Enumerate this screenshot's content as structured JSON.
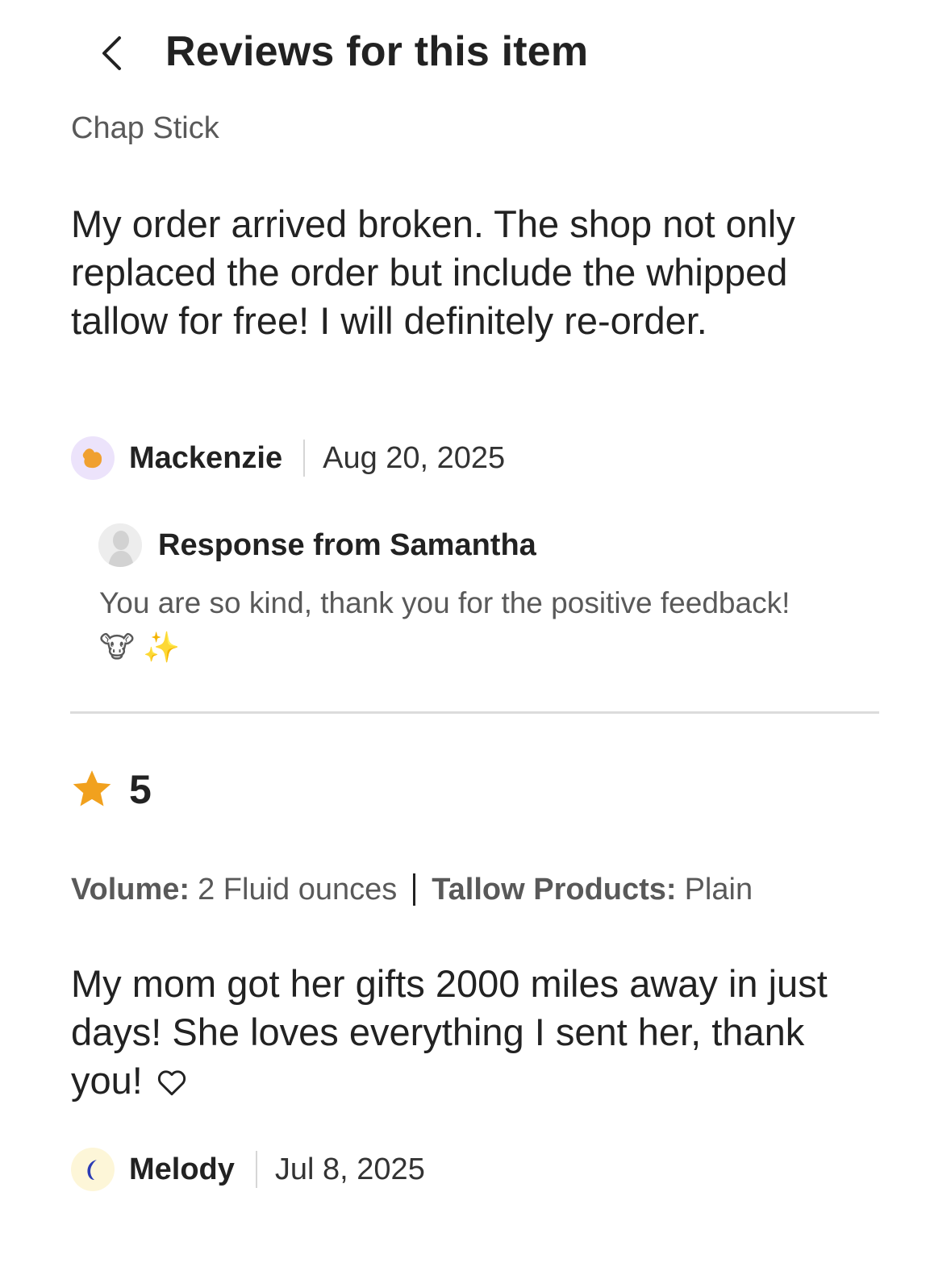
{
  "header": {
    "title": "Reviews for this item",
    "back_icon": "chevron-left-icon"
  },
  "reviews": [
    {
      "item": "Chap Stick",
      "text": "My order arrived broken. The shop not only replaced the order but include the whipped tallow for free! I will definitely re-order.",
      "reviewer": "Mackenzie",
      "date": "Aug 20, 2025",
      "avatar_icon": "orange-blob-icon",
      "avatar_color": "#f0a030",
      "response": {
        "title": "Response from Samantha",
        "text_main": "You are so kind, thank you for the positive feedback!",
        "emojis": "🐮 ✨",
        "avatar_icon": "shop-owner-avatar"
      }
    },
    {
      "rating": "5",
      "star_color": "#f1a11e",
      "variations": [
        {
          "label": "Volume:",
          "value": "2 Fluid ounces"
        },
        {
          "label": "Tallow Products:",
          "value": "Plain"
        }
      ],
      "text": "My mom got her gifts 2000 miles away in just days! She loves everything I sent her, thank you!",
      "reviewer": "Melody",
      "date": "Jul 8, 2025",
      "avatar_icon": "blue-moon-icon",
      "avatar_color": "#2b3bb5"
    }
  ]
}
